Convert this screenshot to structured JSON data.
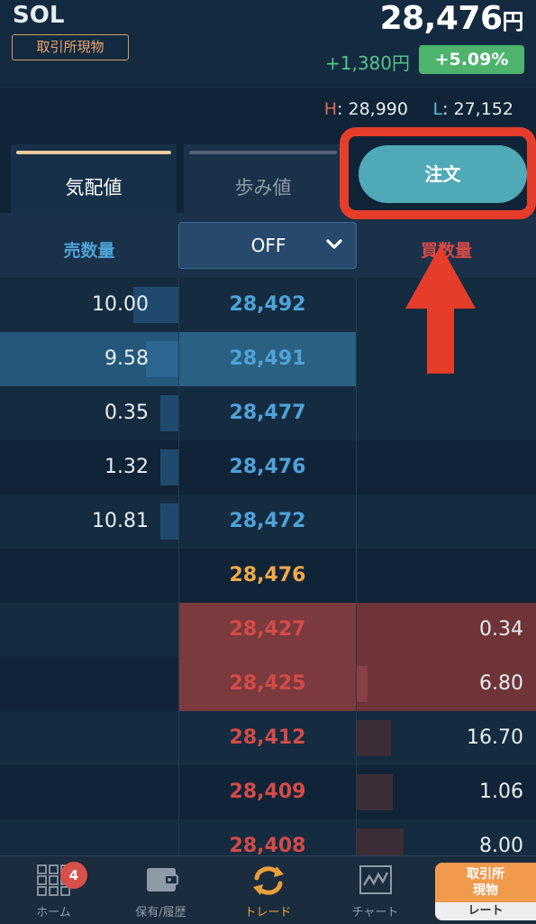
{
  "header": {
    "symbol": "SOL",
    "market_badge": "取引所現物",
    "price": "28,476",
    "price_unit": "円",
    "change_abs": "+1,380円",
    "change_pct": "+5.09%",
    "high_letter": "H",
    "high_value": ": 28,990",
    "low_letter": "L",
    "low_value": ": 27,152"
  },
  "tabs": [
    {
      "label": "気配値",
      "active": true
    },
    {
      "label": "歩み値",
      "active": false
    }
  ],
  "order_button": "注文",
  "columns": {
    "sell_qty": "売数量",
    "buy_qty": "買数量",
    "select_value": "OFF"
  },
  "book": {
    "asks": [
      {
        "qty": "10.00",
        "price": "28,492",
        "depth": 0.25
      },
      {
        "qty": "9.58",
        "price": "28,491",
        "depth": 0.18
      },
      {
        "qty": "0.35",
        "price": "28,477",
        "depth": 0.1
      },
      {
        "qty": "1.32",
        "price": "28,476",
        "depth": 0.1
      },
      {
        "qty": "10.81",
        "price": "28,472",
        "depth": 0.1
      }
    ],
    "last": {
      "price": "28,476"
    },
    "bids": [
      {
        "qty": "0.34",
        "price": "28,427",
        "depth": 0.0
      },
      {
        "qty": "6.80",
        "price": "28,425",
        "depth": 0.06
      },
      {
        "qty": "16.70",
        "price": "28,412",
        "depth": 0.19
      },
      {
        "qty": "1.06",
        "price": "28,409",
        "depth": 0.2
      },
      {
        "qty": "8.00",
        "price": "28,408",
        "depth": 0.26
      }
    ]
  },
  "bottom_nav": [
    {
      "label": "ホーム",
      "icon": "grid-icon",
      "badge": "4"
    },
    {
      "label": "保有/履歴",
      "icon": "wallet-icon"
    },
    {
      "label": "トレード",
      "icon": "trade-arrows-icon",
      "active": true
    },
    {
      "label": "チャート",
      "icon": "chart-icon"
    }
  ],
  "rate_box": {
    "top": "取引所\n現物",
    "top_line1": "取引所",
    "top_line2": "現物",
    "bottom": "レート"
  },
  "colors": {
    "accent_orange": "#f19a4e",
    "ask_blue": "#4ea3d8",
    "bid_red": "#d44b47",
    "positive_green": "#4db36d",
    "annotation_red": "#e53d2a"
  }
}
